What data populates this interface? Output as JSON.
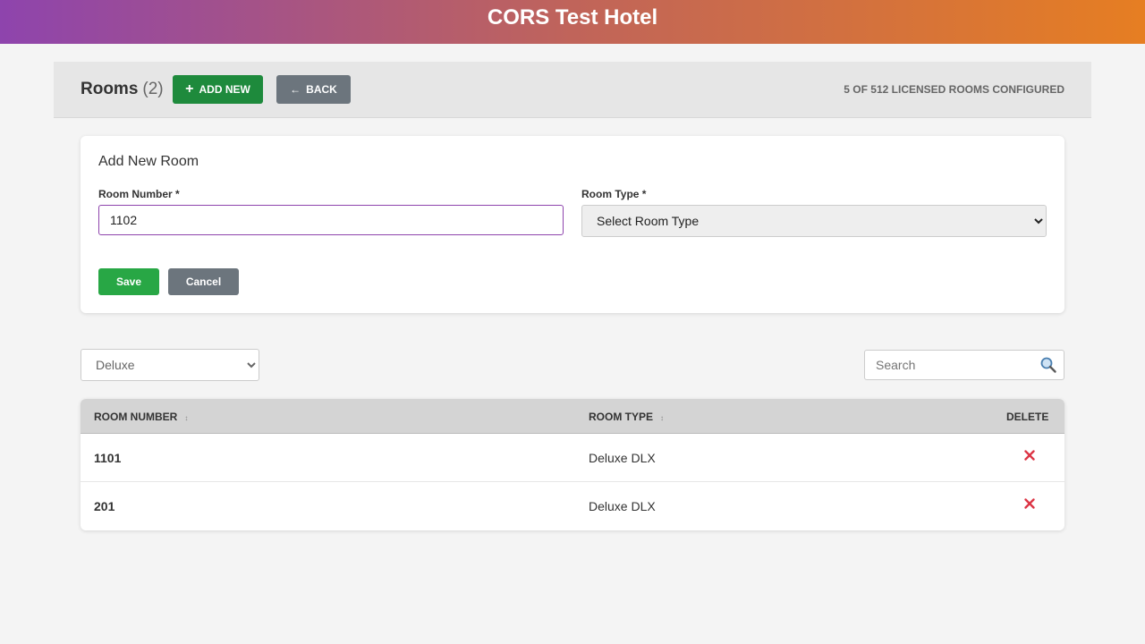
{
  "app": {
    "title": "CORS Test Hotel"
  },
  "header": {
    "title": "Rooms",
    "count": "(2)",
    "add_new_label": "ADD NEW",
    "back_label": "BACK",
    "license_text": "5 OF 512 LICENSED ROOMS CONFIGURED"
  },
  "form": {
    "title": "Add New Room",
    "room_number_label": "Room Number *",
    "room_number_value": "1102",
    "room_type_label": "Room Type *",
    "room_type_selected": "Select Room Type",
    "save_label": "Save",
    "cancel_label": "Cancel"
  },
  "filter": {
    "selected": "Deluxe"
  },
  "search": {
    "placeholder": "Search"
  },
  "table": {
    "columns": [
      "ROOM NUMBER",
      "ROOM TYPE",
      "DELETE"
    ],
    "rows": [
      {
        "room_number": "1101",
        "room_type": "Deluxe DLX"
      },
      {
        "room_number": "201",
        "room_type": "Deluxe DLX"
      }
    ]
  },
  "colors": {
    "header_gradient_start": "#8e44ad",
    "header_gradient_end": "#e67e22",
    "add_button": "#1e8a3c",
    "save_button": "#28a745",
    "secondary_button": "#6c757d",
    "delete_icon": "#dc3545"
  },
  "icons": {
    "add": "plus-icon",
    "back": "arrow-left-icon",
    "search": "search-icon",
    "delete": "close-icon"
  }
}
